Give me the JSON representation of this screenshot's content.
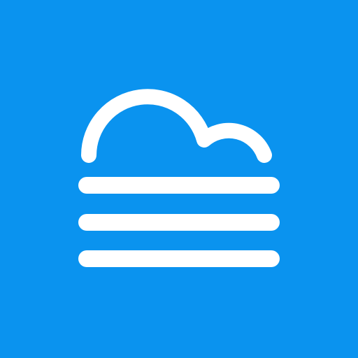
{
  "icon": {
    "name": "fog-weather-icon",
    "background_color": "#0a93ef",
    "glyph_color": "#ffffff",
    "parts": [
      "cloud-outline",
      "fog-line",
      "fog-line",
      "fog-line"
    ]
  }
}
